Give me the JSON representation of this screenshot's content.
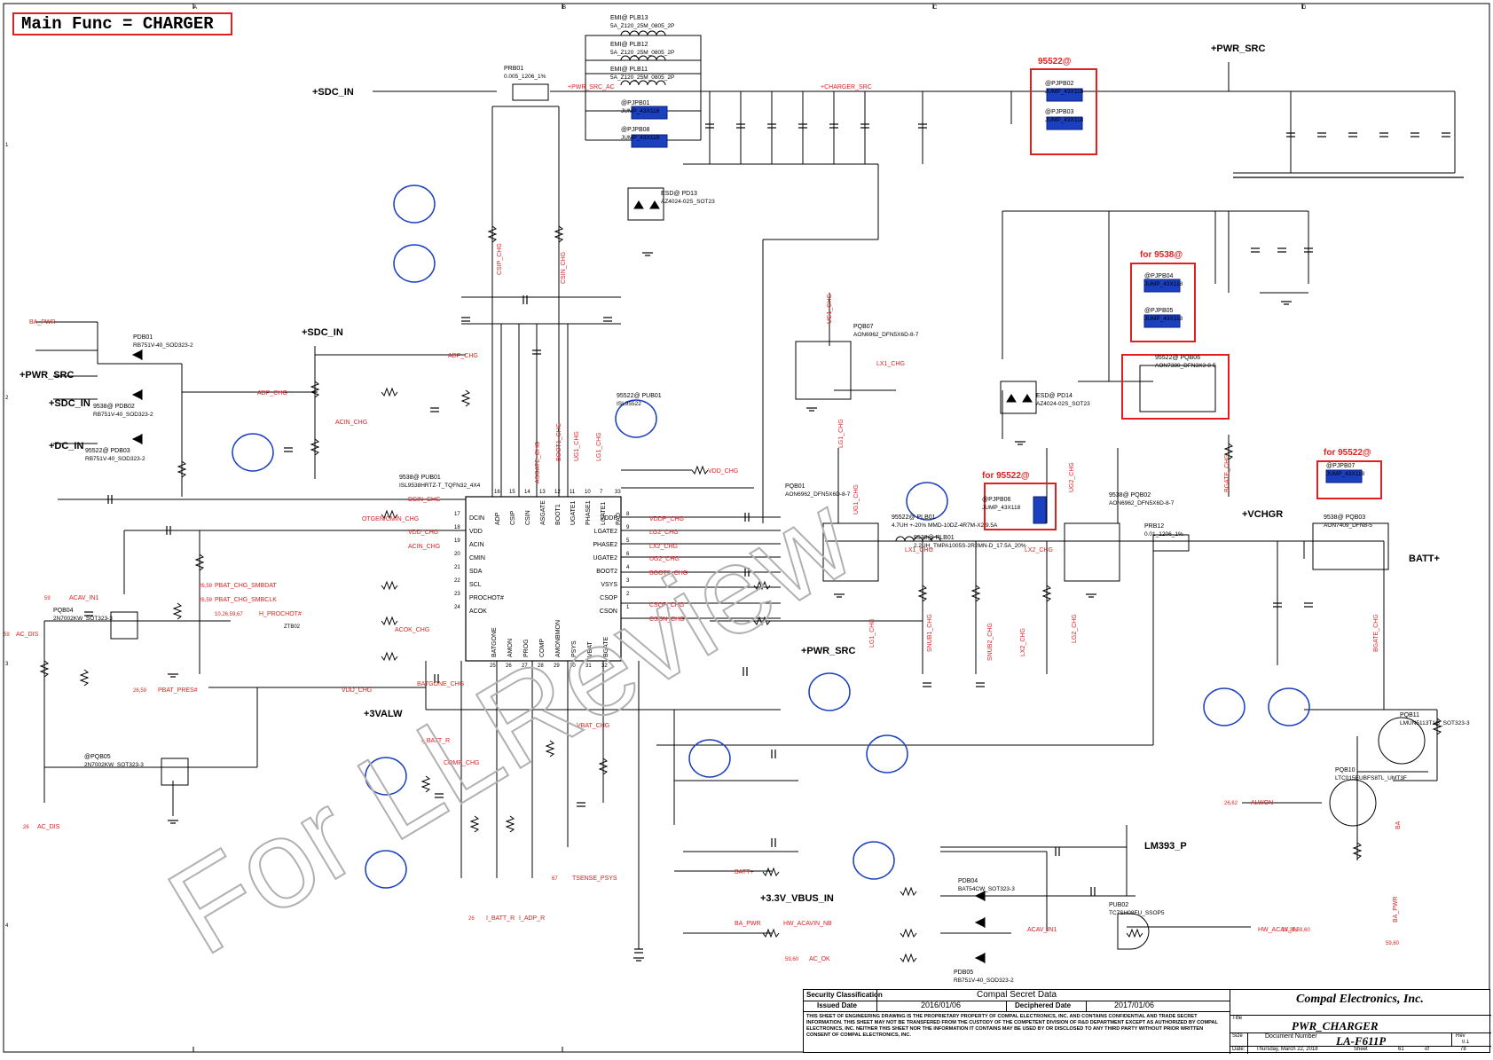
{
  "header": {
    "main_func": "Main Func = CHARGER"
  },
  "border": {
    "columns": [
      "A",
      "B",
      "C",
      "D"
    ],
    "rows": [
      "1",
      "2",
      "3",
      "4"
    ]
  },
  "power_nets": {
    "sdc_in": "+SDC_IN",
    "pwr_src_top": "+PWR_SRC",
    "pwr_src_mid": "+PWR_SRC",
    "vchgr": "+VCHGR",
    "batt": "BATT+",
    "dc_in": "+DC_IN",
    "sdc_in_left": "+SDC_IN",
    "sdc_in_mid": "+SDC_IN",
    "pwr_src_left": "+PWR_SRC",
    "threevalw": "+3VALW",
    "v33_vbus": "+3.3V_VBUS_IN",
    "lm393": "LM393_P"
  },
  "highlight_boxes": {
    "b95522_top": "95522@",
    "b9538": "for 9538@",
    "b95522_mid": "for 95522@",
    "b95522_right": "for 95522@"
  },
  "components": {
    "plb13": [
      "EMI@ PLB13",
      "5A_Z120_25M_0805_2P"
    ],
    "plb12": [
      "EMI@ PLB12",
      "5A_Z120_25M_0805_2P"
    ],
    "plb11": [
      "EMI@ PLB11",
      "5A_Z120_25M_0805_2P"
    ],
    "prb01": [
      "PRB01",
      "0.005_1206_1%"
    ],
    "pjpb01": [
      "@PJPB01",
      "JUMP_43X118"
    ],
    "pjpb08": [
      "@PJPB08",
      "JUMP_43X118"
    ],
    "pjpb02": [
      "@PJPB02",
      "JUMP_43X118"
    ],
    "pjpb03": [
      "@PJPB03",
      "JUMP_43X118"
    ],
    "pjpb04": [
      "@PJPB04",
      "JUMP_43X118"
    ],
    "pjpb05": [
      "@PJPB05",
      "JUMP_43X118"
    ],
    "pjpb06": [
      "@PJPB06",
      "JUMP_43X118"
    ],
    "pjpb07": [
      "@PJPB07",
      "JUMP_43X118"
    ],
    "pd13": [
      "ESD@ PD13",
      "AZ4024-02S_SOT23"
    ],
    "pd14": [
      "ESD@ PD14",
      "AZ4024-02S_SOT23"
    ],
    "pub01": [
      "9538@ PUB01",
      "ISL9538HRTZ-T_TQFN32_4X4"
    ],
    "pub01b": [
      "95522@ PUB01",
      "ISL95522"
    ],
    "pqb07": [
      "PQB07",
      "AON6962_DFN5X6D-8-7"
    ],
    "pqb01": [
      "PQB01",
      "AON6962_DFN5X6D-8-7"
    ],
    "pqb02": [
      "9538@ PQB02",
      "AON6962_DFN5X6D-8-7"
    ],
    "pqb06": [
      "95522@ PQB06",
      "AON7380_DFN3X3-8-5"
    ],
    "pqb03": [
      "9538@ PQB03",
      "AON7409_DFN8-5"
    ],
    "plb01": [
      "9538@ PLB01",
      "2.2UH_TMPA1005S-2R2MN-D_17.5A_20%"
    ],
    "plb01b": [
      "95522@ PLB01",
      "4.7UH +-20% MMD-10DZ-4R7M-X2 9.5A"
    ],
    "prb12": [
      "PRB12",
      "0.01_1206_1%"
    ],
    "pdb01": [
      "PDB01",
      "RB751V-40_SOD323-2"
    ],
    "pdb02": [
      "9538@ PDB02",
      "RB751V-40_SOD323-2"
    ],
    "pdb03": [
      "95522@ PDB03",
      "RB751V-40_SOD323-2"
    ],
    "pdb04": [
      "PDB04",
      "BAT54CW_SOT323-3"
    ],
    "pdb05": [
      "PDB05",
      "RB751V-40_SOD323-2"
    ],
    "pqb04": [
      "PQB04",
      "2N7002KW_SOT323-3"
    ],
    "pqb05": [
      "@PQB05",
      "2N7002KW_SOT323-3"
    ],
    "pqb11": [
      "PQB11",
      "LMUN5113T1G_SOT323-3"
    ],
    "pqb10": [
      "PQB10",
      "LTC015EUBFS8TL_UMT3F"
    ],
    "pub02": [
      "PUB02",
      "TC7SH08FU_SSOP5"
    ]
  },
  "ic": {
    "left_pins": [
      {
        "name": "DCIN",
        "num": "17"
      },
      {
        "name": "VDD",
        "num": "18"
      },
      {
        "name": "ACIN",
        "num": "19"
      },
      {
        "name": "CMIN",
        "num": "20"
      },
      {
        "name": "SDA",
        "num": "21"
      },
      {
        "name": "SCL",
        "num": "22"
      },
      {
        "name": "PROCHOT#",
        "num": "23"
      },
      {
        "name": "ACOK",
        "num": "24"
      }
    ],
    "right_pins": [
      {
        "name": "VDDP",
        "num": "8"
      },
      {
        "name": "LGATE2",
        "num": "9"
      },
      {
        "name": "PHASE2",
        "num": "5"
      },
      {
        "name": "UGATE2",
        "num": "6"
      },
      {
        "name": "BOOT2",
        "num": "4"
      },
      {
        "name": "VSYS",
        "num": "3"
      },
      {
        "name": "CSOP",
        "num": "2"
      },
      {
        "name": "CSON",
        "num": "1"
      }
    ],
    "top_pins": [
      "ADP",
      "CSIP",
      "CSIN",
      "ASGATE",
      "BOOT1",
      "UGATE1",
      "PHASE1",
      "LGATE1",
      "PAD"
    ],
    "top_nums": [
      "16",
      "15",
      "14",
      "13",
      "12",
      "11",
      "10",
      "7",
      "33"
    ],
    "bottom_pins": [
      "BATGONE",
      "AMON",
      "PROG",
      "COMP",
      "AMONBMON",
      "PSYS",
      "VBAT",
      "BGATE"
    ],
    "bottom_nums": [
      "25",
      "26",
      "27",
      "28",
      "29",
      "30",
      "31",
      "32"
    ]
  },
  "net_labels": {
    "ba_pwr": "BA_PWR",
    "adp_chg": "ADP_CHG",
    "adp_chg2": "ADP_CHG",
    "acin_chg": "ACIN_CHG",
    "dcin_chg": "DCIN_CHG",
    "otgen": "OTGEN/CMIN_CHG",
    "vdd_chg": "VDD_CHG",
    "acin_chg2": "ACIN_CHG",
    "smbdat": "PBAT_CHG_SMBDAT",
    "smbclk": "PBAT_CHG_SMBCLK",
    "prochot": "H_PROCHOT#",
    "acok": "ACOK_CHG",
    "acav_in1": "ACAV_IN1",
    "ac_dis": "AC_DIS",
    "ac_dis_ref": "59",
    "ac_dis2": "AC_DIS",
    "ac_dis2_ref": "26",
    "acav_ref": "59",
    "pbat_pres": "PBAT_PRES#",
    "pbat_pres_ref": "26,59",
    "batgone": "BATGONE_CHG",
    "vdd_chg2": "VDD_CHG",
    "ibatt_r": "I_BATT_R",
    "ibatt_r2": "I_BATT_R",
    "iadp_r": "I_ADP_R",
    "ref_26": "26",
    "comp_chg": "COMP_CHG",
    "vbat_chg": "VBAT_CHG",
    "batt_plus": "BATT+",
    "tsense": "TSENSE_PSYS",
    "ref_67": "67",
    "vdd_chg3": "VDD_CHG",
    "vddp_chg": "VDDP_CHG",
    "lg2_chg": "LG2_CHG",
    "lx2_chg": "LX2_CHG",
    "ug2_chg": "UG2_CHG",
    "boot2_chg": "BOOT2_CHG",
    "csop_chg": "CSOP_CHG",
    "cson_chg": "CSON_CHG",
    "lx1_chg": "LX1_CHG",
    "ug1_chg": "UG1_CHG",
    "lg1_chg": "LG1_CHG",
    "lg1_chg2": "LG1_CHG",
    "ug1_chg2": "UG1_CHG",
    "lx1_chg2": "LX1_CHG",
    "lx2_chg2": "LX2_CHG",
    "ug2_chg2": "UG2_CHG",
    "lg2_chg2": "LG2_CHG",
    "lx2_chg3": "LX2_CHG",
    "snub1": "SNUB1_CHG",
    "snub2": "SNUB2_CHG",
    "bgate": "BGATE_CHG",
    "bgate2": "BGATE_CHG",
    "charger_src": "+CHARGER_SRC",
    "pwr_src_ac": "+PWR_SRC_AC",
    "ba_pwr2": "BA_PWR",
    "hw_acavin_nb": "HW_ACAVIN_NB",
    "hw_acav_in": "HW_ACAV_IN",
    "hw_ref": "18,26,59,60",
    "acav_in1b": "ACAV_IN1",
    "ac_ok": "AC_OK",
    "ac_ok_ref": "59,60",
    "alwon": "ALWON",
    "alwon_ref": "26,62",
    "ba": "BA",
    "ba_pwr3": "BA_PWR",
    "ba_pwr_ref": "59,60",
    "csip": "CSIP_CHG",
    "csin": "CSIN_CHG",
    "asgate": "ASGATE_CHG",
    "boot1": "BOOT1_CHG",
    "phase1": "UG1_CHG",
    "lgate1": "LG1_CHG",
    "chg_ref1": "26,59",
    "chg_ref2": "26,59",
    "chg_ref3": "10,26,59,67",
    "ztb02": "ZTB02"
  },
  "watermark": "For LLReview",
  "title_block": {
    "security_label": "Security Classification",
    "security_value": "Compal Secret Data",
    "issued_label": "Issued Date",
    "issued_value": "2016/01/06",
    "deciphered_label": "Deciphered Date",
    "deciphered_value": "2017/01/06",
    "company": "Compal Electronics, Inc.",
    "title_label": "Title",
    "title_value": "PWR_CHARGER",
    "size_label": "Size",
    "docnum_label": "Document Number",
    "doc_value": "LA-F611P",
    "rev_label": "Rev",
    "rev_value": "0.1",
    "date_label": "Date:",
    "date_value": "Thursday, March 22, 2018",
    "sheet_label": "Sheet",
    "sheet_value": "61",
    "of_label": "of",
    "of_value": "78",
    "legal": "THIS SHEET OF ENGINEERING DRAWING IS THE PROPRIETARY PROPERTY OF COMPAL ELECTRONICS, INC. AND CONTAINS CONFIDENTIAL AND TRADE SECRET INFORMATION. THIS SHEET MAY NOT BE TRANSFERED FROM THE CUSTODY OF THE COMPETENT DIVISION OF R&D DEPARTMENT EXCEPT AS AUTHORIZED BY COMPAL ELECTRONICS, INC. NEITHER THIS SHEET NOR THE INFORMATION IT CONTAINS MAY BE USED BY OR DISCLOSED TO ANY THIRD PARTY WITHOUT PRIOR WRITTEN CONSENT OF COMPAL ELECTRONICS, INC."
  },
  "colors": {
    "wire": "#000000",
    "net_red": "#e02020",
    "part_blue": "#1a3fbf",
    "highlight": "#e02020",
    "watermark": "#b0b0b0"
  }
}
